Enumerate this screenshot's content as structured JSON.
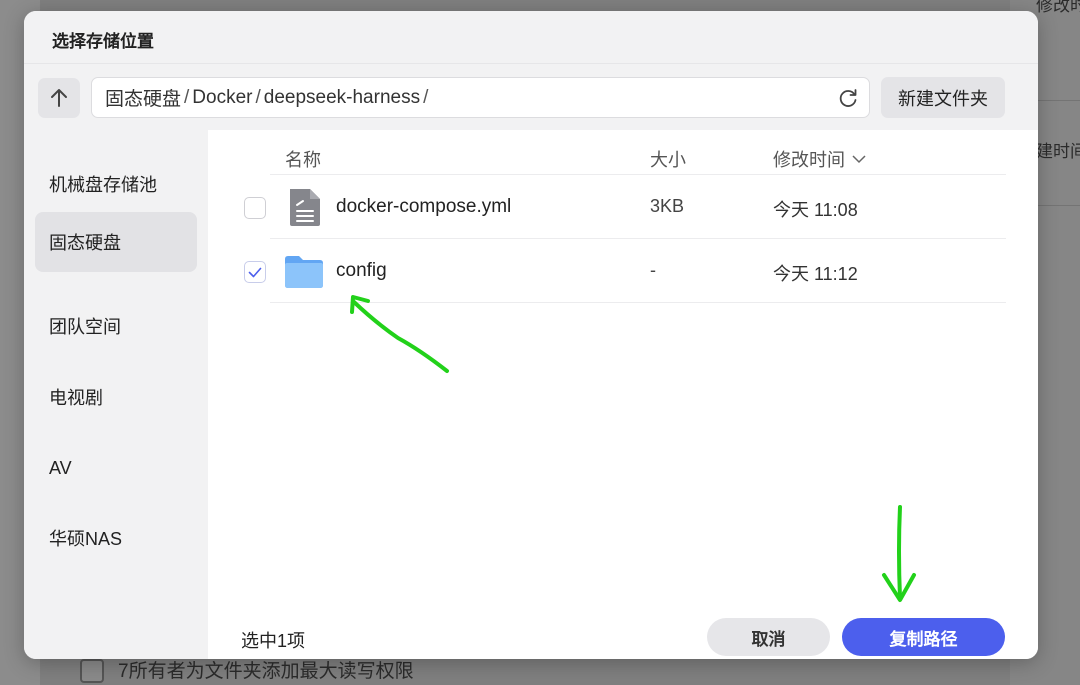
{
  "background": {
    "right_texts": [
      "修改时间",
      "建时间"
    ],
    "bottom_text": "7所有者为文件夹添加最大读写权限"
  },
  "dialog": {
    "title": "选择存储位置",
    "breadcrumb": [
      "固态硬盘",
      "Docker",
      "deepseek-harness"
    ],
    "separator": "/",
    "new_folder_label": "新建文件夹",
    "sidebar": [
      {
        "label": "机械盘存储池",
        "active": false
      },
      {
        "label": "固态硬盘",
        "active": true
      },
      {
        "label": "团队空间",
        "active": false
      },
      {
        "label": "电视剧",
        "active": false
      },
      {
        "label": "AV",
        "active": false
      },
      {
        "label": "华硕NAS",
        "active": false
      }
    ],
    "columns": {
      "name": "名称",
      "size": "大小",
      "modified": "修改时间"
    },
    "files": [
      {
        "name": "docker-compose.yml",
        "size": "3KB",
        "modified": "今天 11:08",
        "type": "file-icon",
        "checked": false
      },
      {
        "name": "config",
        "size": "-",
        "modified": "今天 11:12",
        "type": "folder-icon",
        "checked": true
      }
    ],
    "selected_count": "选中1项",
    "cancel_label": "取消",
    "copy_path_label": "复制路径"
  },
  "colors": {
    "primary": "#4c5fed",
    "annotation": "#22d11a",
    "folder": "#7eb8f7"
  }
}
